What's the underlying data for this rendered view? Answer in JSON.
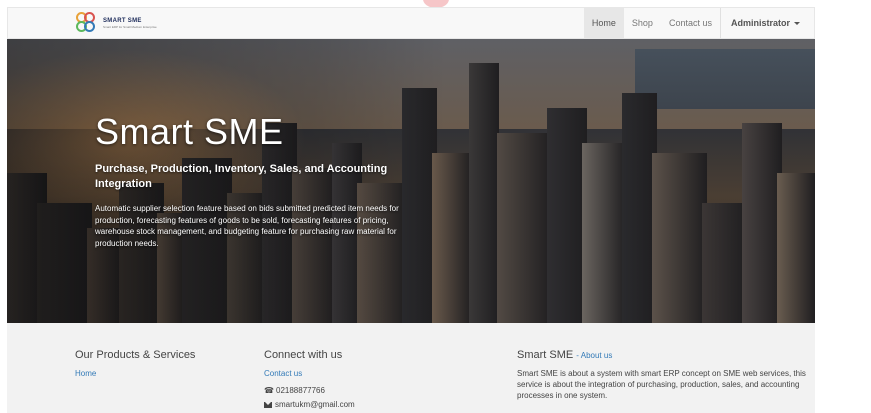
{
  "navbar": {
    "brand_name": "SMART SME",
    "brand_tagline": "Smart ERP for Small Medium Enterprise",
    "links": [
      "Home",
      "Shop",
      "Contact us"
    ],
    "user_menu": "Administrator"
  },
  "hero": {
    "title": "Smart SME",
    "subtitle": "Purchase, Production, Inventory, Sales, and Accounting Integration",
    "description": "Automatic supplier selection feature based on bids submitted predicted item needs for production, forecasting features of goods to be sold, forecasting features of pricing, warehouse stock management, and budgeting feature for purchasing raw material for production needs."
  },
  "footer": {
    "products": {
      "heading": "Our Products & Services",
      "link": "Home"
    },
    "connect": {
      "heading": "Connect with us",
      "link": "Contact us",
      "phone": "02188877766",
      "email": "smartukm@gmail.com"
    },
    "about": {
      "heading": "Smart SME",
      "link": "- About us",
      "text": "Smart SME is about a system with smart ERP concept on SME web services, this service is about the integration of purchasing, production, sales, and accounting processes in one system."
    }
  },
  "colors": {
    "link": "#337ab7",
    "navbar_bg": "#f8f8f8",
    "footer_bg": "#f2f2f2"
  },
  "icons": [
    "logo-circles-icon",
    "caret-down-icon",
    "phone-icon",
    "envelope-icon"
  ]
}
